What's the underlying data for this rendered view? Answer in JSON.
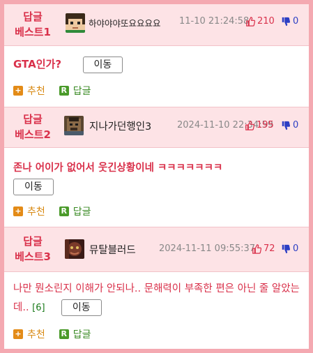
{
  "posts": [
    {
      "rank_line1": "답글",
      "rank_line2": "베스트1",
      "nickname": "하야야야또요요요요",
      "date": "11-10 21:24:58",
      "upvotes": "210",
      "downvotes": "0",
      "text": "GTA인가?",
      "comment_count": "",
      "move_label": "이동",
      "recommend_label": "추천",
      "reply_label": "답글"
    },
    {
      "rank_line1": "답글",
      "rank_line2": "베스트2",
      "nickname": "지나가던행인3",
      "date": "2024-11-10 22:34:59",
      "upvotes": "195",
      "downvotes": "0",
      "text": "존나 어이가 없어서 웃긴상황이네 ㅋㅋㅋㅋㅋㅋㅋ",
      "comment_count": "",
      "move_label": "이동",
      "recommend_label": "추천",
      "reply_label": "답글"
    },
    {
      "rank_line1": "답글",
      "rank_line2": "베스트3",
      "nickname": "뮤탈블러드",
      "date": "2024-11-11 09:55:37",
      "upvotes": "72",
      "downvotes": "0",
      "text": "나만 뭔소린지 이해가 안되나.. 문해력이 부족한 편은 아닌 줄 알았는데..",
      "comment_count": "[6]",
      "move_label": "이동",
      "recommend_label": "추천",
      "reply_label": "답글"
    }
  ],
  "colors": {
    "accent": "#d9304a",
    "header_bg": "#fde3e6",
    "border": "#f4a9b1",
    "down": "#2c3fc4",
    "recommend": "#e38b17",
    "reply": "#4a9a2a"
  }
}
